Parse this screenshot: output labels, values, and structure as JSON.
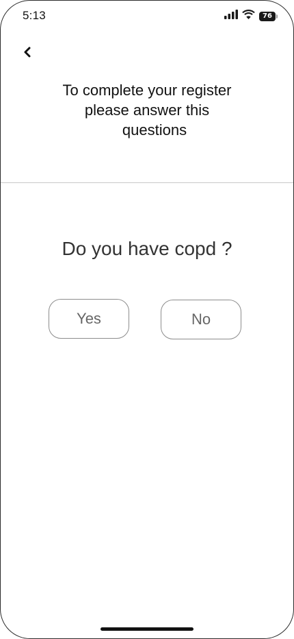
{
  "status_bar": {
    "time": "5:13",
    "battery_level": "76",
    "icons": [
      "signal-icon",
      "wifi-icon",
      "battery-icon"
    ]
  },
  "header": {
    "back_icon": "chevron-left-icon",
    "title_line1": "To complete your register",
    "title_line2": "please answer this",
    "title_line3": "questions"
  },
  "question": {
    "text": "Do you have copd ?"
  },
  "answers": {
    "yes_label": "Yes",
    "no_label": "No"
  },
  "colors": {
    "background": "#ffffff",
    "text": "#111111",
    "question_text": "#333333",
    "button_text": "#666666",
    "button_border": "#8c8c8c",
    "divider": "#c8c8c8"
  }
}
